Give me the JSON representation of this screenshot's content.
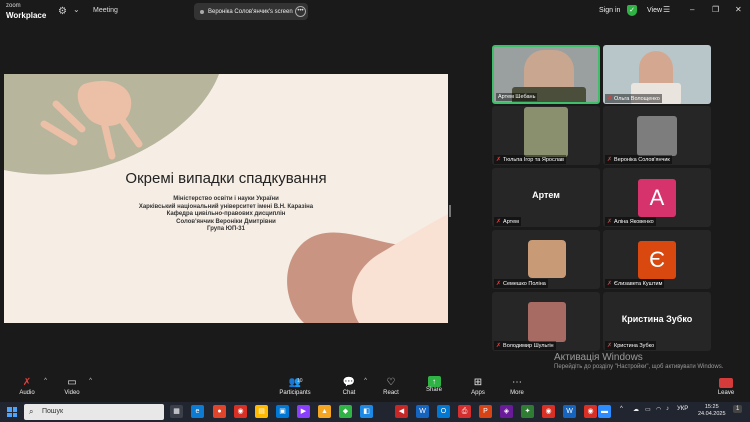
{
  "topbar": {
    "brand_line1": "zoom",
    "brand_line2": "Workplace",
    "meeting_label": "Meeting",
    "share_label": "Вероніка Солов'янчик's screen",
    "signin_label": "Sign in",
    "view_label": "View"
  },
  "slide": {
    "title": "Окремі випадки спадкування",
    "lines": [
      "Міністерство освіти і науки України",
      "Харківський національний університет імені В.Н. Каразіна",
      "Кафедра цивільно-правових дисциплін",
      "Солов'янчик Вероніки Дмитрівни",
      "Група ЮП-31"
    ],
    "colors": {
      "bg": "#f6eee5",
      "sage": "#b7b59c",
      "peach": "#ecbfa7",
      "terracotta": "#c99582",
      "cream": "#f9e1d3"
    }
  },
  "participants": [
    {
      "name": "Артем Шебань",
      "kind": "video",
      "active": true
    },
    {
      "name": "Ольга Волощенко",
      "kind": "video"
    },
    {
      "name": "Тюльпа Ігор та Ярослав",
      "kind": "photo"
    },
    {
      "name": "Вероніка Солов'янчик",
      "kind": "photo"
    },
    {
      "name": "Артем",
      "kind": "text",
      "display": "Артем"
    },
    {
      "name": "Аліна Яковенко",
      "kind": "avatar",
      "letter": "A",
      "color": "#d6336c"
    },
    {
      "name": "Семешко Поліна",
      "kind": "photo"
    },
    {
      "name": "Єлизавета Куштим",
      "kind": "avatar",
      "letter": "Є",
      "color": "#d9480f"
    },
    {
      "name": "Володимир Шульгін",
      "kind": "photo"
    },
    {
      "name": "Кристина Зубко",
      "kind": "text",
      "display": "Кристина Зубко"
    }
  ],
  "toolbar": {
    "audio": "Audio",
    "video": "Video",
    "participants": "Participants",
    "participants_count": "10",
    "chat": "Chat",
    "react": "React",
    "share": "Share",
    "apps": "Apps",
    "more": "More",
    "leave": "Leave"
  },
  "watermark": {
    "title": "Активація Windows",
    "body": "Перейдіть до розділу \"Настройки\", щоб активувати Windows."
  },
  "taskbar": {
    "search_placeholder": "Пошук",
    "lang": "УКР",
    "time": "15:25",
    "date": "24.04.2025",
    "notif_count": "1"
  }
}
